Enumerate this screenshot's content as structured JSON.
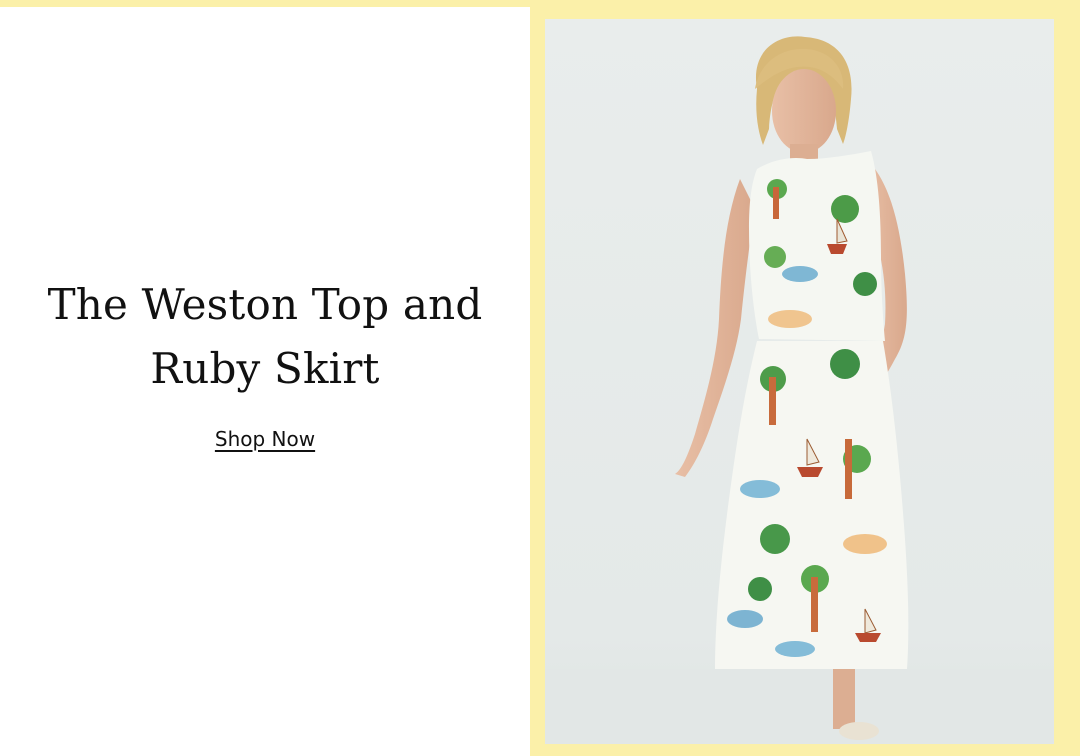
{
  "promo": {
    "headline": "The Weston Top and Ruby Skirt",
    "cta_label": "Shop Now"
  },
  "image": {
    "subject": "model wearing a tropical print sleeveless top and matching midi skirt"
  },
  "colors": {
    "frame": "#fbf0a9",
    "backdrop": "#e8eceb",
    "text": "#111111"
  }
}
